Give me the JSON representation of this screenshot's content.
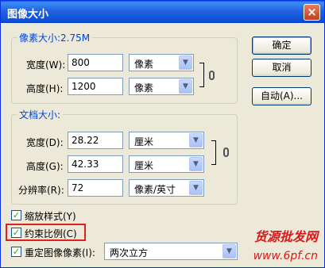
{
  "window": {
    "title": "图像大小",
    "close": "×"
  },
  "pixel_dimensions": {
    "legend": "像素大小:2.75M",
    "width_label": "宽度(W):",
    "width_value": "800",
    "width_unit": "像素",
    "height_label": "高度(H):",
    "height_value": "1200",
    "height_unit": "像素"
  },
  "document_size": {
    "legend": "文档大小:",
    "width_label": "宽度(D):",
    "width_value": "28.22",
    "width_unit": "厘米",
    "height_label": "高度(G):",
    "height_value": "42.33",
    "height_unit": "厘米",
    "resolution_label": "分辨率(R):",
    "resolution_value": "72",
    "resolution_unit": "像素/英寸"
  },
  "buttons": {
    "ok": "确定",
    "cancel": "取消",
    "auto": "自动(A)..."
  },
  "options": {
    "scale_styles": "缩放样式(Y)",
    "constrain_proportions": "约束比例(C)",
    "resample": "重定图像像素(I):",
    "resample_method": "两次立方"
  },
  "watermark": {
    "line1": "货源批发网",
    "line2": "www.6pf.cn"
  },
  "colors": {
    "legend": "#0046d5",
    "highlight": "#e02020",
    "watermark": "#d91a1a"
  }
}
